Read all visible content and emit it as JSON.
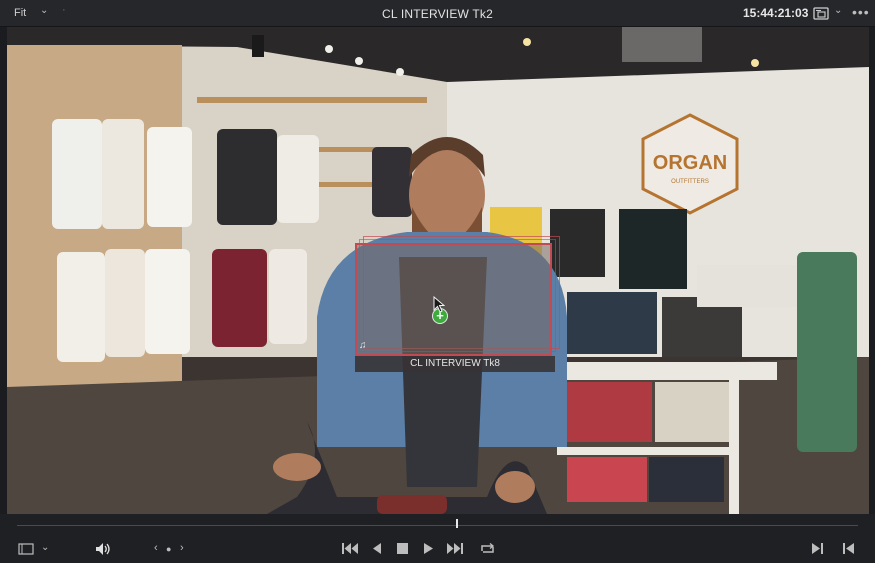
{
  "toolbar": {
    "zoom_label": "Fit",
    "clip_name": "CL INTERVIEW Tk2",
    "timecode": "15:44:21:03"
  },
  "drag": {
    "clip_label": "CL INTERVIEW Tk8"
  },
  "scene": {
    "store_sign_line1": "ORGAN",
    "store_sign_line2": "OUTFITTERS"
  },
  "colors": {
    "drag_border": "#c24a52",
    "add_badge": "#3dab3d",
    "panel_bg": "#26272b",
    "transport_bg": "#1f2024"
  },
  "playback": {
    "playhead_fraction": 0.52
  }
}
